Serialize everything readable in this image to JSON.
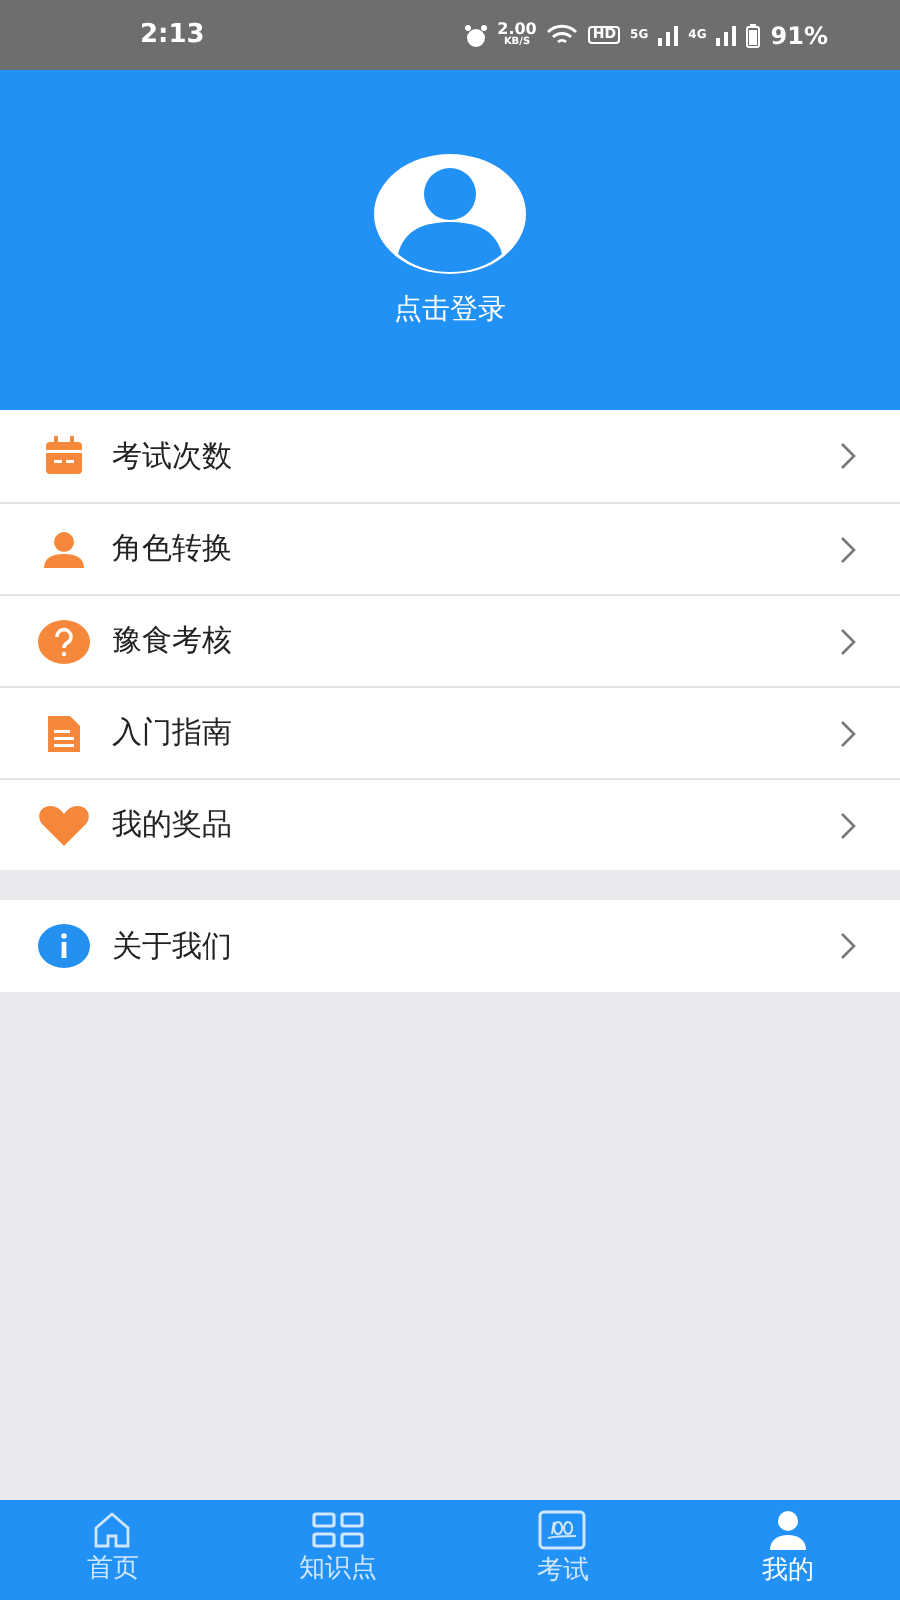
{
  "status_bar": {
    "time": "2:13",
    "speed": "2.00",
    "speed_unit": "KB/S",
    "hd": "HD",
    "net_1": "5G",
    "net_2": "4G",
    "battery": "91%"
  },
  "profile": {
    "login_label": "点击登录"
  },
  "menu_groups": [
    [
      {
        "label": "考试次数",
        "kind": "calendar"
      },
      {
        "label": "角色转换",
        "kind": "person"
      },
      {
        "label": "豫食考核",
        "kind": "question"
      },
      {
        "label": "入门指南",
        "kind": "document"
      },
      {
        "label": "我的奖品",
        "kind": "heart"
      }
    ],
    [
      {
        "label": "关于我们",
        "kind": "info"
      }
    ]
  ],
  "bottom_nav": [
    {
      "label": "首页",
      "kind": "home",
      "selected": false
    },
    {
      "label": "知识点",
      "kind": "grid",
      "selected": false
    },
    {
      "label": "考试",
      "kind": "score",
      "selected": false
    },
    {
      "label": "我的",
      "kind": "person",
      "selected": true
    }
  ]
}
